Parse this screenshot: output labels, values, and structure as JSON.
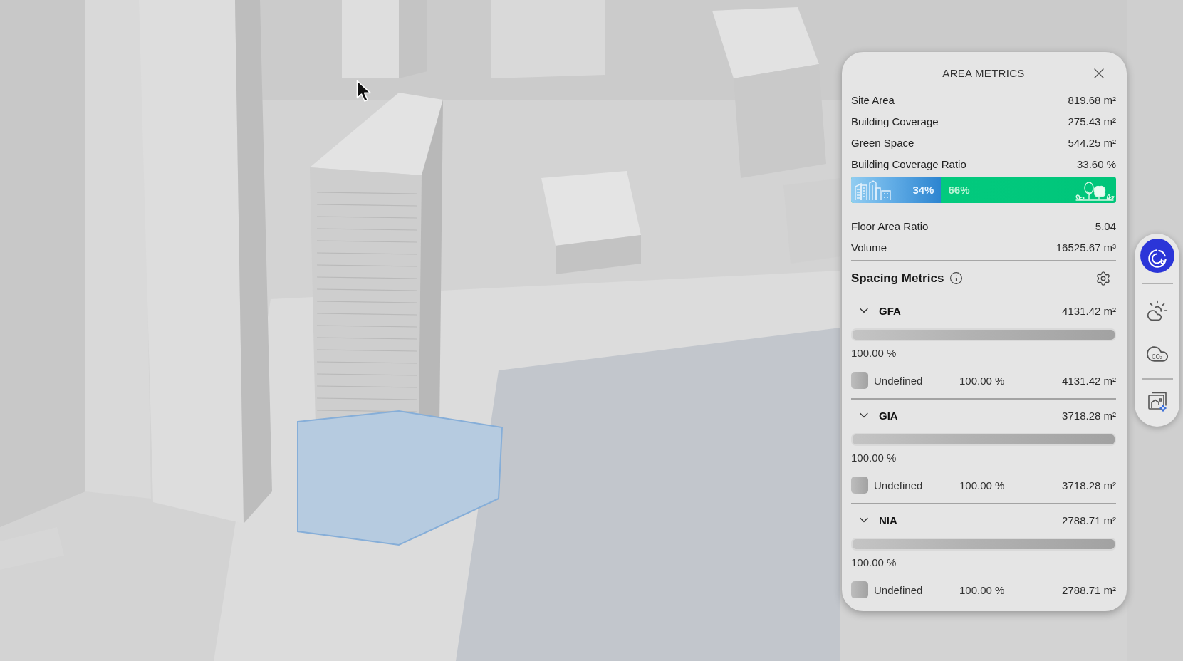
{
  "panel": {
    "title": "AREA METRICS",
    "metrics": [
      {
        "label": "Site Area",
        "value": "819.68 m²"
      },
      {
        "label": "Building Coverage",
        "value": "275.43 m²"
      },
      {
        "label": "Green Space",
        "value": "544.25 m²"
      },
      {
        "label": "Building Coverage Ratio",
        "value": "33.60 %"
      }
    ],
    "coverage_bar": {
      "level": 0.34,
      "built_label": "34%",
      "green_label": "66%"
    },
    "ratios": [
      {
        "label": "Floor Area Ratio",
        "value": "5.04"
      },
      {
        "label": "Volume",
        "value": "16525.67 m³"
      }
    ],
    "spacing": {
      "title": "Spacing Metrics",
      "groups": [
        {
          "name": "GFA",
          "value": "4131.42 m²",
          "expanded": true,
          "level": 1,
          "percent": "100.00 %",
          "items": [
            {
              "label": "Undefined",
              "percent": "100.00 %",
              "value": "4131.42 m²"
            }
          ]
        },
        {
          "name": "GIA",
          "value": "3718.28 m²",
          "expanded": true,
          "level": 1,
          "percent": "100.00 %",
          "items": [
            {
              "label": "Undefined",
              "percent": "100.00 %",
              "value": "3718.28 m²"
            }
          ]
        },
        {
          "name": "NIA",
          "value": "2788.71 m²",
          "expanded": true,
          "level": 1,
          "percent": "100.00 %",
          "items": [
            {
              "label": "Undefined",
              "percent": "100.00 %",
              "value": "2788.71 m²"
            }
          ]
        }
      ]
    }
  },
  "toolbar": {
    "groups": [
      {
        "tools": [
          {
            "kind": "metrics",
            "selected": true
          }
        ]
      },
      {
        "tools": [
          {
            "kind": "sun",
            "selected": false
          },
          {
            "kind": "co2",
            "selected": false,
            "label": "CO₂"
          }
        ]
      },
      {
        "tools": [
          {
            "kind": "ai_view",
            "selected": false
          }
        ]
      }
    ]
  }
}
